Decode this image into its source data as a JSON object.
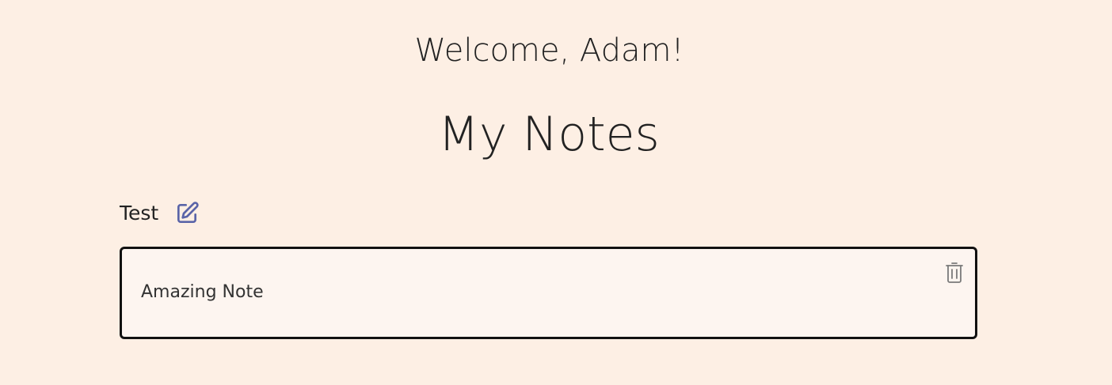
{
  "header": {
    "welcome": "Welcome, Adam!",
    "title": "My Notes"
  },
  "groups": [
    {
      "name": "Test",
      "edit_icon": "edit-icon",
      "notes": [
        {
          "text": "Amazing Note",
          "delete_icon": "trash-icon"
        }
      ]
    }
  ],
  "colors": {
    "background": "#fdefe4",
    "card_background": "#fdf5f0",
    "card_border": "#111111",
    "edit_icon": "#5a64a8",
    "delete_icon": "#7a7a7a",
    "text": "#222222"
  }
}
